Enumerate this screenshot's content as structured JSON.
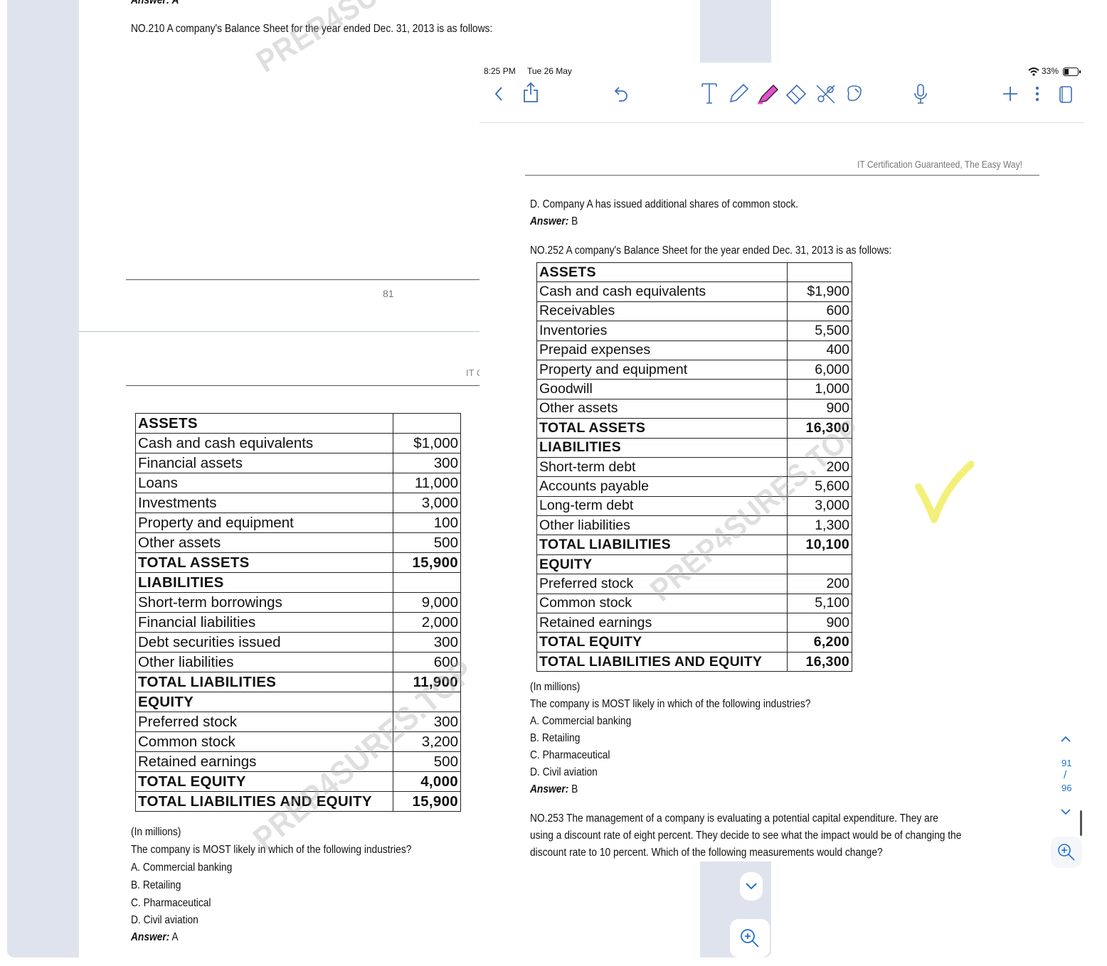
{
  "outer": {
    "answer_top": "Answer: A",
    "question_title": "NO.210 A company's Balance Sheet for the year ended Dec. 31, 2013 is as follows:",
    "page_number": "81",
    "header_fragment": "IT C",
    "watermark": "PREP4SURES.TOP",
    "balance_sheet": [
      {
        "label": "ASSETS",
        "value": "",
        "bold": true
      },
      {
        "label": "Cash and cash equivalents",
        "value": "$1,000",
        "bold": false
      },
      {
        "label": "Financial assets",
        "value": "300",
        "bold": false
      },
      {
        "label": "Loans",
        "value": "11,000",
        "bold": false
      },
      {
        "label": "Investments",
        "value": "3,000",
        "bold": false
      },
      {
        "label": "Property and equipment",
        "value": "100",
        "bold": false
      },
      {
        "label": "Other assets",
        "value": "500",
        "bold": false
      },
      {
        "label": "TOTAL ASSETS",
        "value": "15,900",
        "bold": true
      },
      {
        "label": "LIABILITIES",
        "value": "",
        "bold": true
      },
      {
        "label": "Short-term borrowings",
        "value": "9,000",
        "bold": false
      },
      {
        "label": "Financial liabilities",
        "value": "2,000",
        "bold": false
      },
      {
        "label": "Debt securities issued",
        "value": "300",
        "bold": false
      },
      {
        "label": "Other liabilities",
        "value": "600",
        "bold": false
      },
      {
        "label": "TOTAL LIABILITIES",
        "value": "11,900",
        "bold": true
      },
      {
        "label": "EQUITY",
        "value": "",
        "bold": true
      },
      {
        "label": "Preferred stock",
        "value": "300",
        "bold": false
      },
      {
        "label": "Common stock",
        "value": "3,200",
        "bold": false
      },
      {
        "label": "Retained earnings",
        "value": "500",
        "bold": false
      },
      {
        "label": "TOTAL EQUITY",
        "value": "4,000",
        "bold": true
      },
      {
        "label": "TOTAL LIABILITIES AND EQUITY",
        "value": "15,900",
        "bold": true
      }
    ],
    "units_note": "(In millions)",
    "question": "The company is MOST likely in which of the following industries?",
    "options": [
      "A. Commercial banking",
      "B. Retailing",
      "C. Pharmaceutical",
      "D. Civil aviation"
    ],
    "answer_label": "Answer:",
    "answer_value": "A"
  },
  "ipad": {
    "status": {
      "time": "8:25 PM",
      "date": "Tue 26 May",
      "battery": "33%"
    },
    "toolbar": {
      "icons": [
        "back-icon",
        "share-icon",
        "undo-icon",
        "text-tool-icon",
        "pen-icon",
        "highlighter-icon",
        "eraser-icon",
        "scissors-icon",
        "lasso-icon",
        "microphone-icon",
        "add-icon",
        "more-icon",
        "pages-icon"
      ]
    },
    "doc": {
      "header": "IT Certification Guaranteed, The Easy Way!",
      "prev_option": "D. Company A has issued additional shares of common stock.",
      "prev_answer_label": "Answer:",
      "prev_answer_value": "B",
      "question_title": "NO.252 A company's Balance Sheet for the year ended Dec. 31, 2013 is as follows:",
      "balance_sheet": [
        {
          "label": "ASSETS",
          "value": "",
          "bold": true
        },
        {
          "label": "Cash and cash equivalents",
          "value": "$1,900",
          "bold": false
        },
        {
          "label": "Receivables",
          "value": "600",
          "bold": false
        },
        {
          "label": "Inventories",
          "value": "5,500",
          "bold": false
        },
        {
          "label": "Prepaid expenses",
          "value": "400",
          "bold": false
        },
        {
          "label": "Property and equipment",
          "value": "6,000",
          "bold": false
        },
        {
          "label": "Goodwill",
          "value": "1,000",
          "bold": false
        },
        {
          "label": "Other assets",
          "value": "900",
          "bold": false
        },
        {
          "label": "TOTAL ASSETS",
          "value": "16,300",
          "bold": true
        },
        {
          "label": "LIABILITIES",
          "value": "",
          "bold": true
        },
        {
          "label": "Short-term debt",
          "value": "200",
          "bold": false
        },
        {
          "label": "Accounts payable",
          "value": "5,600",
          "bold": false
        },
        {
          "label": "Long-term debt",
          "value": "3,000",
          "bold": false
        },
        {
          "label": "Other liabilities",
          "value": "1,300",
          "bold": false
        },
        {
          "label": "TOTAL LIABILITIES",
          "value": "10,100",
          "bold": true
        },
        {
          "label": "EQUITY",
          "value": "",
          "bold": true
        },
        {
          "label": "Preferred stock",
          "value": "200",
          "bold": false
        },
        {
          "label": "Common stock",
          "value": "5,100",
          "bold": false
        },
        {
          "label": "Retained earnings",
          "value": "900",
          "bold": false
        },
        {
          "label": "TOTAL EQUITY",
          "value": "6,200",
          "bold": true
        },
        {
          "label": "TOTAL LIABILITIES AND EQUITY",
          "value": "16,300",
          "bold": true
        }
      ],
      "units_note": "(In millions)",
      "question": "The company is MOST likely in which of the following industries?",
      "options": [
        "A. Commercial banking",
        "B. Retailing",
        "C. Pharmaceutical",
        "D. Civil aviation"
      ],
      "answer_label": "Answer:",
      "answer_value": "B",
      "next_question_lines": [
        "NO.253 The management of a company is evaluating a potential capital expenditure. They are",
        "using a discount rate of eight percent. They decide to see what the impact would be of changing the",
        "discount rate to 10 percent. Which of the following measurements would change?"
      ],
      "watermark": "PREP4SURES.TOP"
    },
    "page_indicator": {
      "current": "91",
      "separator": "/",
      "total": "96"
    },
    "colors": {
      "checkmark": "#f3f07a",
      "accent": "#1f6fd0"
    }
  }
}
